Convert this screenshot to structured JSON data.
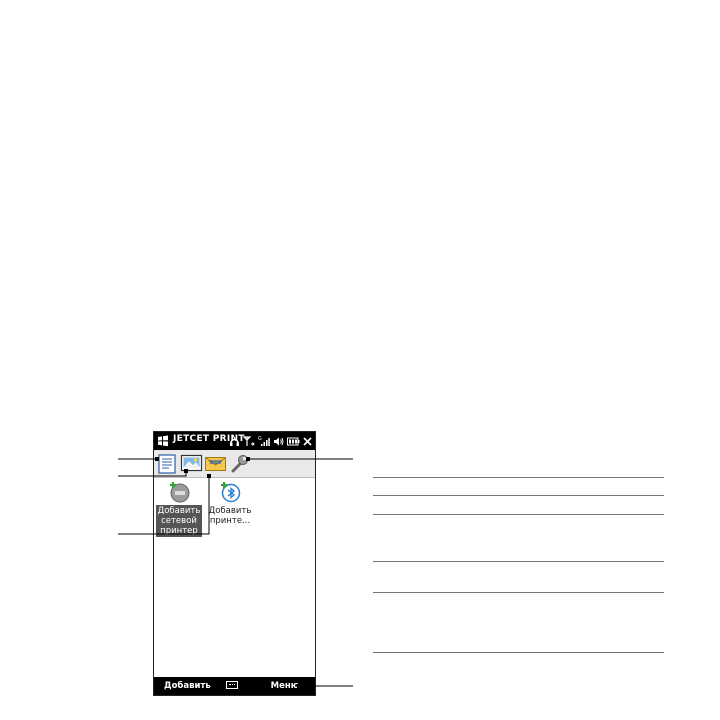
{
  "app": {
    "title": "JETCET PRINT"
  },
  "tabs": [
    {
      "name": "documents-tab",
      "icon": "document-icon"
    },
    {
      "name": "pictures-tab",
      "icon": "picture-icon"
    },
    {
      "name": "email-tab",
      "icon": "envelope-icon"
    },
    {
      "name": "settings-tab",
      "icon": "wrench-icon"
    }
  ],
  "items": [
    {
      "label_lines": [
        "Добавить",
        "сетевой",
        "принтер"
      ],
      "icon": "network-printer-add-icon",
      "selected": true
    },
    {
      "label_lines": [
        "Добавить",
        "принте..."
      ],
      "icon": "bluetooth-printer-add-icon",
      "selected": false
    }
  ],
  "softkeys": {
    "left": "Добавить",
    "right": "Меню",
    "center_icon": "keyboard-icon"
  },
  "status_icons": [
    "headset-icon",
    "signal-antenna-icon",
    "network-g-icon",
    "volume-icon",
    "battery-icon",
    "close-icon"
  ],
  "colors": {
    "bar": "#000000",
    "tabbar": "#e9e9e9",
    "selection": "#555555"
  }
}
